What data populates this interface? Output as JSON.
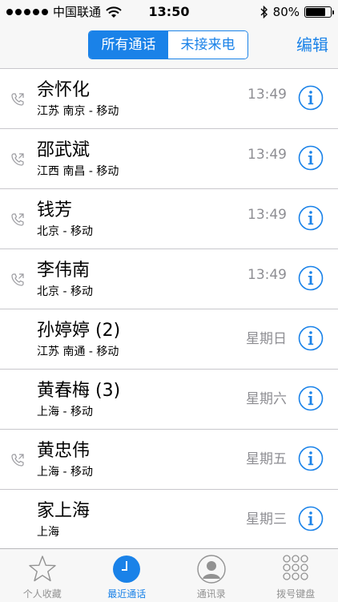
{
  "status_bar": {
    "carrier": "中国联通",
    "time": "13:50",
    "battery": "80%",
    "battery_level": 0.8
  },
  "nav": {
    "segments": [
      "所有通话",
      "未接来电"
    ],
    "active_segment": 0,
    "edit_label": "编辑"
  },
  "calls": [
    {
      "name": "佘怀化",
      "location": "江苏 南京 - 移动",
      "time": "13:49",
      "outgoing": true
    },
    {
      "name": "邵武斌",
      "location": "江西 南昌 - 移动",
      "time": "13:49",
      "outgoing": true
    },
    {
      "name": "钱芳",
      "location": "北京 - 移动",
      "time": "13:49",
      "outgoing": true
    },
    {
      "name": "李伟南",
      "location": "北京 - 移动",
      "time": "13:49",
      "outgoing": true
    },
    {
      "name": "孙婷婷 (2)",
      "location": "江苏 南通 - 移动",
      "time": "星期日",
      "outgoing": false
    },
    {
      "name": "黄春梅 (3)",
      "location": "上海 - 移动",
      "time": "星期六",
      "outgoing": false
    },
    {
      "name": "黄忠伟",
      "location": "上海 - 移动",
      "time": "星期五",
      "outgoing": true
    },
    {
      "name": "家上海",
      "location": "上海",
      "time": "星期三",
      "outgoing": false
    }
  ],
  "tabs": [
    {
      "label": "个人收藏",
      "icon": "star-icon"
    },
    {
      "label": "最近通话",
      "icon": "clock-icon"
    },
    {
      "label": "通讯录",
      "icon": "contacts-icon"
    },
    {
      "label": "拨号键盘",
      "icon": "keypad-icon"
    }
  ],
  "active_tab": 1,
  "colors": {
    "accent": "#1a82e8",
    "secondary_text": "#8e8e93",
    "bar_background": "#f7f7f7"
  }
}
